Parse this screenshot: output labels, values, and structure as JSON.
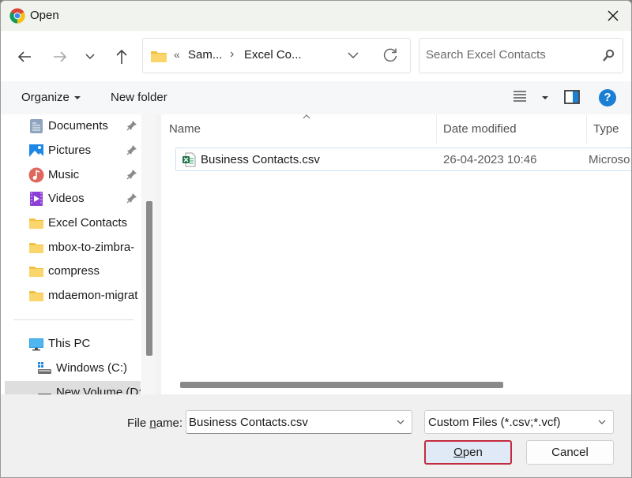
{
  "window": {
    "title": "Open",
    "app_icon": "chrome-icon",
    "close_icon": "close-icon"
  },
  "navigation": {
    "back_icon": "arrow-left-icon",
    "forward_icon": "arrow-right-icon",
    "recent_icon": "chevron-down-icon",
    "up_icon": "arrow-up-icon",
    "address": {
      "folder_icon": "folder-icon",
      "overflow": "«",
      "crumbs": [
        "Sam...",
        "Excel Co..."
      ],
      "separator": "›"
    },
    "refresh_icon": "refresh-icon",
    "search": {
      "placeholder": "Search Excel Contacts",
      "value": ""
    }
  },
  "toolbar": {
    "organize_label": "Organize",
    "new_folder_label": "New folder",
    "view_icon": "list-view-icon",
    "preview_pane_icon": "preview-pane-icon",
    "help_label": "?"
  },
  "sidebar": {
    "items": [
      {
        "label": "Documents",
        "icon": "documents-icon",
        "pinned": true
      },
      {
        "label": "Pictures",
        "icon": "pictures-icon",
        "pinned": true
      },
      {
        "label": "Music",
        "icon": "music-icon",
        "pinned": true
      },
      {
        "label": "Videos",
        "icon": "videos-icon",
        "pinned": true
      },
      {
        "label": "Excel Contacts",
        "icon": "folder-icon",
        "pinned": false
      },
      {
        "label": "mbox-to-zimbra-",
        "icon": "folder-icon",
        "pinned": false
      },
      {
        "label": "compress",
        "icon": "folder-icon",
        "pinned": false
      },
      {
        "label": "mdaemon-migrat",
        "icon": "folder-icon",
        "pinned": false
      }
    ],
    "this_pc": {
      "label": "This PC",
      "icon": "computer-icon"
    },
    "drives": [
      {
        "label": "Windows (C:)",
        "icon": "drive-icon",
        "selected": false
      },
      {
        "label": "New Volume (D:",
        "icon": "drive-icon",
        "selected": true
      }
    ]
  },
  "file_list": {
    "columns": [
      "Name",
      "Date modified",
      "Type"
    ],
    "sort_indicator": "^",
    "rows": [
      {
        "name": "Business Contacts.csv",
        "date_modified": "26-04-2023 10:46",
        "type": "Microsoft Excel Comma Separated Values File",
        "type_visible": "Microso",
        "icon": "excel-csv-icon"
      }
    ]
  },
  "footer": {
    "file_name_label_pre": "File ",
    "file_name_label_accel": "n",
    "file_name_label_post": "ame:",
    "file_name_value": "Business Contacts.csv",
    "file_type_value": "Custom Files (*.csv;*.vcf)",
    "open_label_accel": "O",
    "open_label_rest": "pen",
    "cancel_label": "Cancel"
  },
  "colors": {
    "accent": "#1b7fd4",
    "focus_border": "#c42b3e",
    "open_button_bg": "#dfeaf6",
    "excel_green": "#1d7044",
    "folder_yellow": "#f8d260"
  }
}
